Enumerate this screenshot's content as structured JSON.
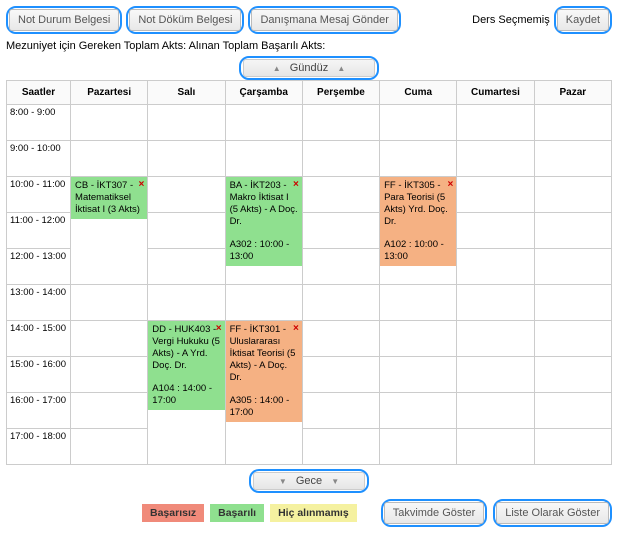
{
  "toolbar": {
    "btn_not_durum": "Not Durum Belgesi",
    "btn_not_dokum": "Not Döküm Belgesi",
    "btn_mesaj": "Danışmana Mesaj Gönder",
    "status_text": "Ders Seçmemiş",
    "btn_kaydet": "Kaydet"
  },
  "subline": "Mezuniyet için Gereken Toplam Akts:  Alınan Toplam Başarılı Akts:",
  "band_day": "Gündüz",
  "band_night": "Gece",
  "columns": [
    "Saatler",
    "Pazartesi",
    "Salı",
    "Çarşamba",
    "Perşembe",
    "Cuma",
    "Cumartesi",
    "Pazar"
  ],
  "times": [
    "8:00 - 9:00",
    "9:00 - 10:00",
    "10:00 - 11:00",
    "11:00 - 12:00",
    "12:00 - 13:00",
    "13:00 - 14:00",
    "14:00 - 15:00",
    "15:00 - 16:00",
    "16:00 - 17:00",
    "17:00 - 18:00"
  ],
  "events": {
    "pzt_10": "CB - İKT307 - Matematiksel İktisat I (3 Akts)",
    "car_10": "BA - İKT203 - Makro İktisat I (5 Akts) - A Doç. Dr.",
    "car_10_loc": "A302 : 10:00 - 13:00",
    "cum_10": "FF - İKT305 - Para Teorisi (5 Akts) Yrd. Doç. Dr.",
    "cum_10_loc": "A102 : 10:00 - 13:00",
    "sal_14": "DD - HUK403 - Vergi Hukuku (5 Akts) - A Yrd. Doç. Dr.",
    "sal_14_loc": "A104 : 14:00 - 17:00",
    "car_14": "FF - İKT301 - Uluslararası İktisat Teorisi (5 Akts) - A Doç. Dr.",
    "car_14_loc": "A305 : 14:00 - 17:00"
  },
  "legend": {
    "fail": "Başarısız",
    "pass": "Başarılı",
    "none": "Hiç alınmamış"
  },
  "footer": {
    "btn_takvim": "Takvimde Göster",
    "btn_liste": "Liste Olarak Göster"
  },
  "chart_data": {
    "type": "table",
    "title": "Gündüz",
    "columns": [
      "Saatler",
      "Pazartesi",
      "Salı",
      "Çarşamba",
      "Perşembe",
      "Cuma",
      "Cumartesi",
      "Pazar"
    ],
    "rows": [
      "8:00 - 9:00",
      "9:00 - 10:00",
      "10:00 - 11:00",
      "11:00 - 12:00",
      "12:00 - 13:00",
      "13:00 - 14:00",
      "14:00 - 15:00",
      "15:00 - 16:00",
      "16:00 - 17:00",
      "17:00 - 18:00"
    ],
    "entries": [
      {
        "day": "Pazartesi",
        "start": "10:00",
        "end": "13:00",
        "code": "CB - İKT307",
        "name": "Matematiksel İktisat I",
        "akts": 3,
        "status": "Başarılı",
        "color": "green"
      },
      {
        "day": "Çarşamba",
        "start": "10:00",
        "end": "13:00",
        "code": "BA - İKT203",
        "name": "Makro İktisat I",
        "akts": 5,
        "section": "A",
        "instructor": "Doç. Dr.",
        "room": "A302",
        "status": "Başarılı",
        "color": "green"
      },
      {
        "day": "Cuma",
        "start": "10:00",
        "end": "13:00",
        "code": "FF - İKT305",
        "name": "Para Teorisi",
        "akts": 5,
        "instructor": "Yrd. Doç. Dr.",
        "room": "A102",
        "status": "Başarısız",
        "color": "orange"
      },
      {
        "day": "Salı",
        "start": "14:00",
        "end": "17:00",
        "code": "DD - HUK403",
        "name": "Vergi Hukuku",
        "akts": 5,
        "section": "A",
        "instructor": "Yrd. Doç. Dr.",
        "room": "A104",
        "status": "Başarılı",
        "color": "green"
      },
      {
        "day": "Çarşamba",
        "start": "14:00",
        "end": "17:00",
        "code": "FF - İKT301",
        "name": "Uluslararası İktisat Teorisi",
        "akts": 5,
        "section": "A",
        "instructor": "Doç. Dr.",
        "room": "A305",
        "status": "Başarısız",
        "color": "orange"
      }
    ]
  }
}
